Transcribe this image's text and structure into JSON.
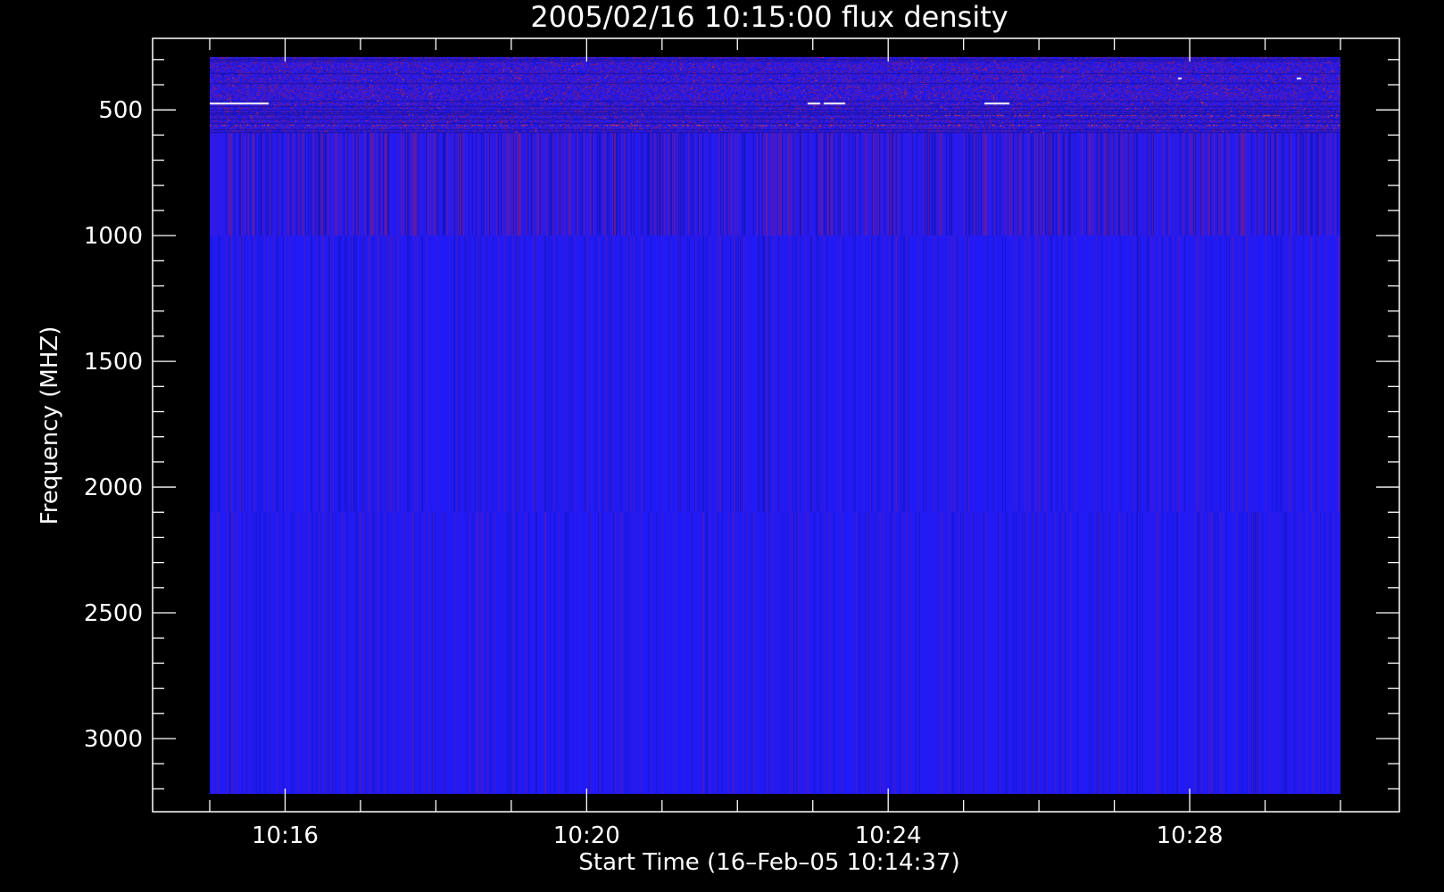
{
  "chart_data": {
    "type": "heatmap",
    "title": "2005/02/16 10:15:00 flux density",
    "xlabel": "Start Time (16–Feb–05 10:14:37)",
    "ylabel": "Frequency (MHZ)",
    "x_ticks": [
      "10:16",
      "10:20",
      "10:24",
      "10:28"
    ],
    "y_ticks": [
      500,
      1000,
      1500,
      2000,
      2500,
      3000
    ],
    "y_inverted": true,
    "ylim": [
      3300,
      235
    ],
    "data_time_range": [
      "10:15:00",
      "10:30:00"
    ],
    "data_frequency_range_mhz": [
      290,
      3220
    ],
    "grid": false,
    "background_color": "#000000",
    "colors": {
      "base": "#1a1aff",
      "low": "#10109a",
      "high": "#b01a40",
      "burst": "#ff5020",
      "saturated": "#ffffff"
    }
  }
}
